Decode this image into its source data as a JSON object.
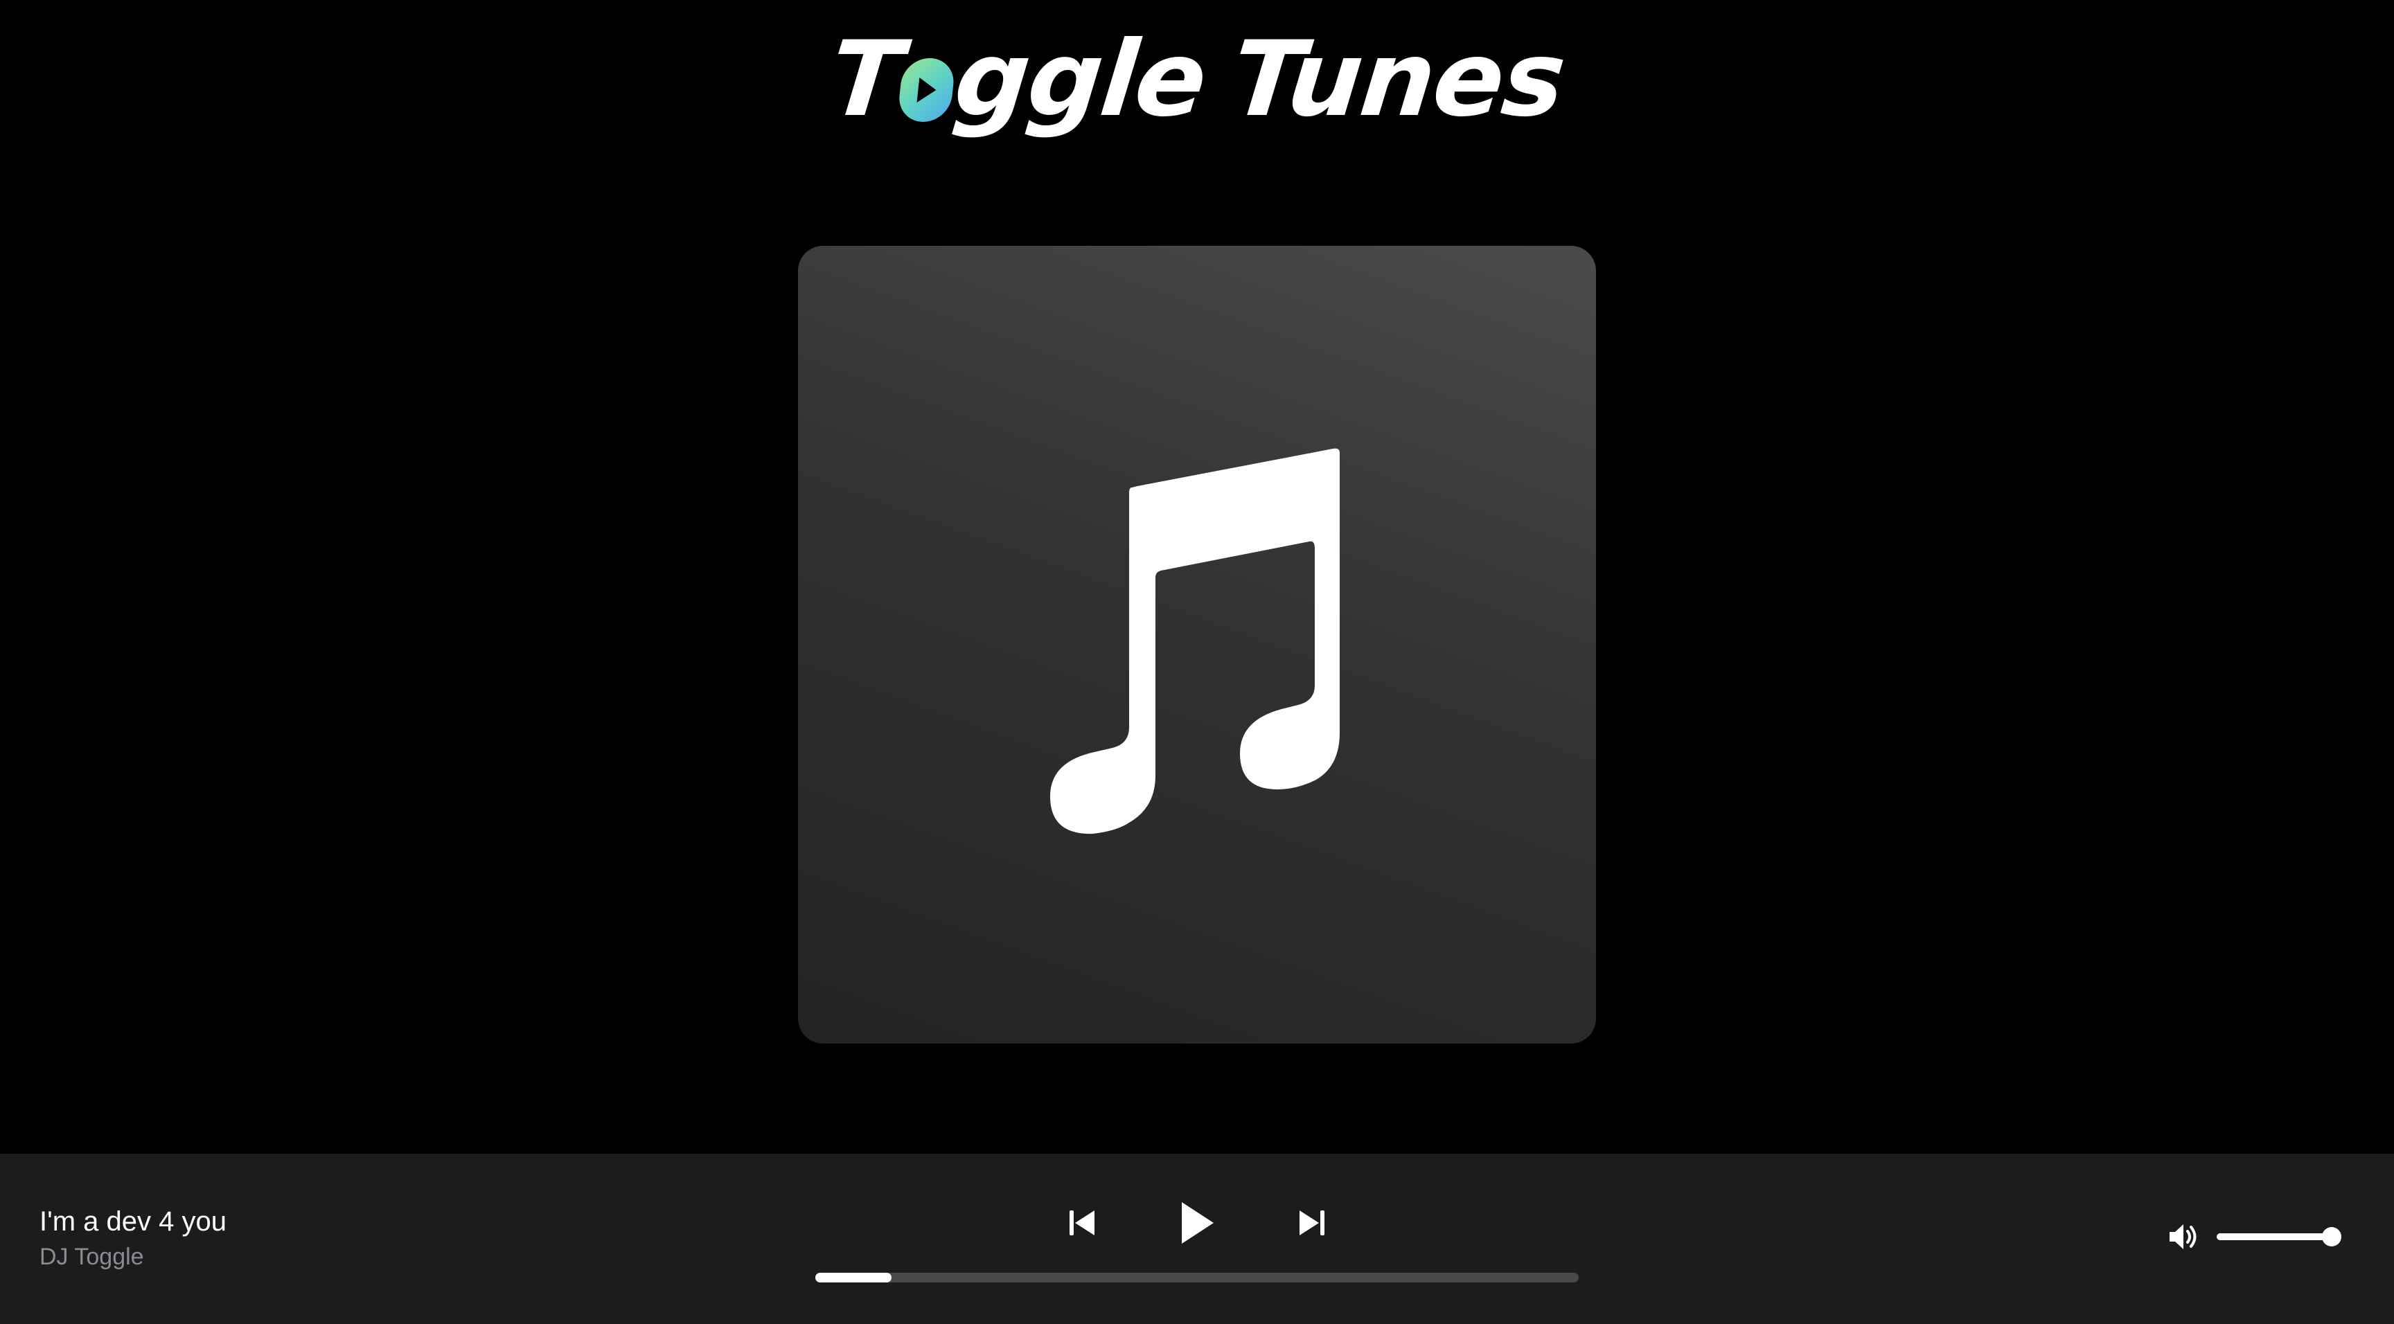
{
  "app": {
    "logo_part_1": "T",
    "logo_part_2": "ggle",
    "logo_part_3": "Tunes",
    "logo_full": "Toggle Tunes"
  },
  "artwork": {
    "icon": "music-note-icon"
  },
  "now_playing": {
    "title": "I'm a dev 4 you",
    "artist": "DJ Toggle"
  },
  "controls": {
    "previous_icon": "skip-previous-icon",
    "play_icon": "play-icon",
    "next_icon": "skip-next-icon"
  },
  "progress": {
    "fraction": 0.1
  },
  "volume": {
    "icon": "volume-icon",
    "level": 0.93
  },
  "colors": {
    "background": "#000000",
    "player_bar": "#1c1c1c",
    "artist_text": "#8b8b95",
    "track_bg": "#4a4a4a",
    "logo_gradient": [
      "#9be58f",
      "#5fd3c4",
      "#4fa9f0"
    ]
  }
}
